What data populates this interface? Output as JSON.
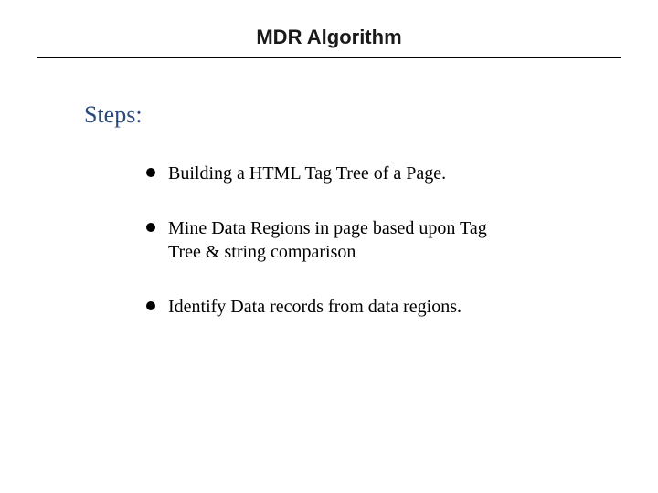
{
  "title": "MDR Algorithm",
  "section_heading": "Steps:",
  "bullets": {
    "item0": " Building a HTML Tag Tree of a Page.",
    "item1": "Mine Data Regions in page based upon Tag Tree  &  string comparison",
    "item2": "Identify Data records from data regions."
  }
}
